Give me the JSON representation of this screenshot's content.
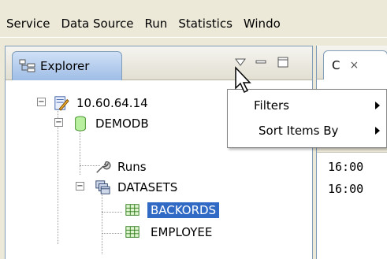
{
  "menubar": {
    "items": [
      "Service",
      "Data Source",
      "Run",
      "Statistics",
      "Windo"
    ]
  },
  "explorer": {
    "tab_label": "Explorer",
    "tab_icon": "hierarchy-icon",
    "toolbar": [
      "view-menu-icon",
      "minimize-icon",
      "maximize-icon"
    ]
  },
  "tree": {
    "server": {
      "label": "10.60.64.14",
      "icon": "server-pencil-icon"
    },
    "database": {
      "label": "DEMODB",
      "icon": "database-icon"
    },
    "runs": {
      "label": "Runs",
      "icon": "wrench-icon"
    },
    "datasets": {
      "label": "DATASETS",
      "icon": "datasets-icon"
    },
    "items": [
      {
        "label": "BACKORDS",
        "icon": "table-icon",
        "selected": true
      },
      {
        "label": "EMPLOYEE",
        "icon": "table-icon",
        "selected": false
      }
    ]
  },
  "right_panel": {
    "tab_label": "C",
    "tab_close": "×",
    "console_lines": [
      "16:00",
      "16:00"
    ]
  },
  "context_menu": {
    "items": [
      {
        "label": "Filters",
        "has_submenu": true
      },
      {
        "label": "Sort Items By",
        "has_submenu": true
      }
    ]
  },
  "colors": {
    "selection": "#316ac5",
    "window_bg": "#ece9d8",
    "tab_active": "#9fbde6"
  }
}
